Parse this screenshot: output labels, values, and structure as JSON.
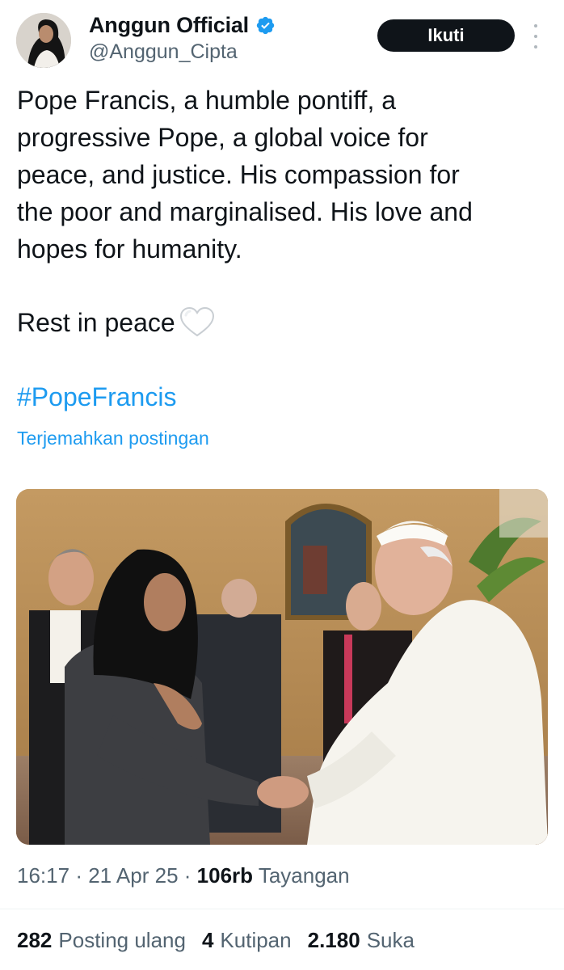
{
  "author": {
    "display_name": "Anggun Official",
    "handle": "@Anggun_Cipta",
    "verified": true
  },
  "actions": {
    "follow_label": "Ikuti",
    "more_icon": "more-vertical-icon"
  },
  "post": {
    "text_lines": [
      "Pope Francis, a humble pontiff, a",
      "progressive Pope, a global voice for",
      "peace, and justice. His compassion for",
      "the poor and marginalised. His love and",
      "hopes for humanity."
    ],
    "closing_line": "Rest in peace",
    "closing_emoji": "white-heart-icon",
    "hashtag": "#PopeFrancis",
    "translate_label": "Terjemahkan postingan"
  },
  "meta": {
    "time": "16:17",
    "date": "21 Apr 25",
    "views_count": "106rb",
    "views_label": "Tayangan",
    "separator": "·"
  },
  "stats": {
    "reposts_count": "282",
    "reposts_label": "Posting ulang",
    "quotes_count": "4",
    "quotes_label": "Kutipan",
    "likes_count": "2.180",
    "likes_label": "Suka"
  },
  "colors": {
    "link": "#1d9bf0",
    "secondary_text": "#536471",
    "primary_text": "#0f1419",
    "follow_bg": "#0f1419"
  }
}
